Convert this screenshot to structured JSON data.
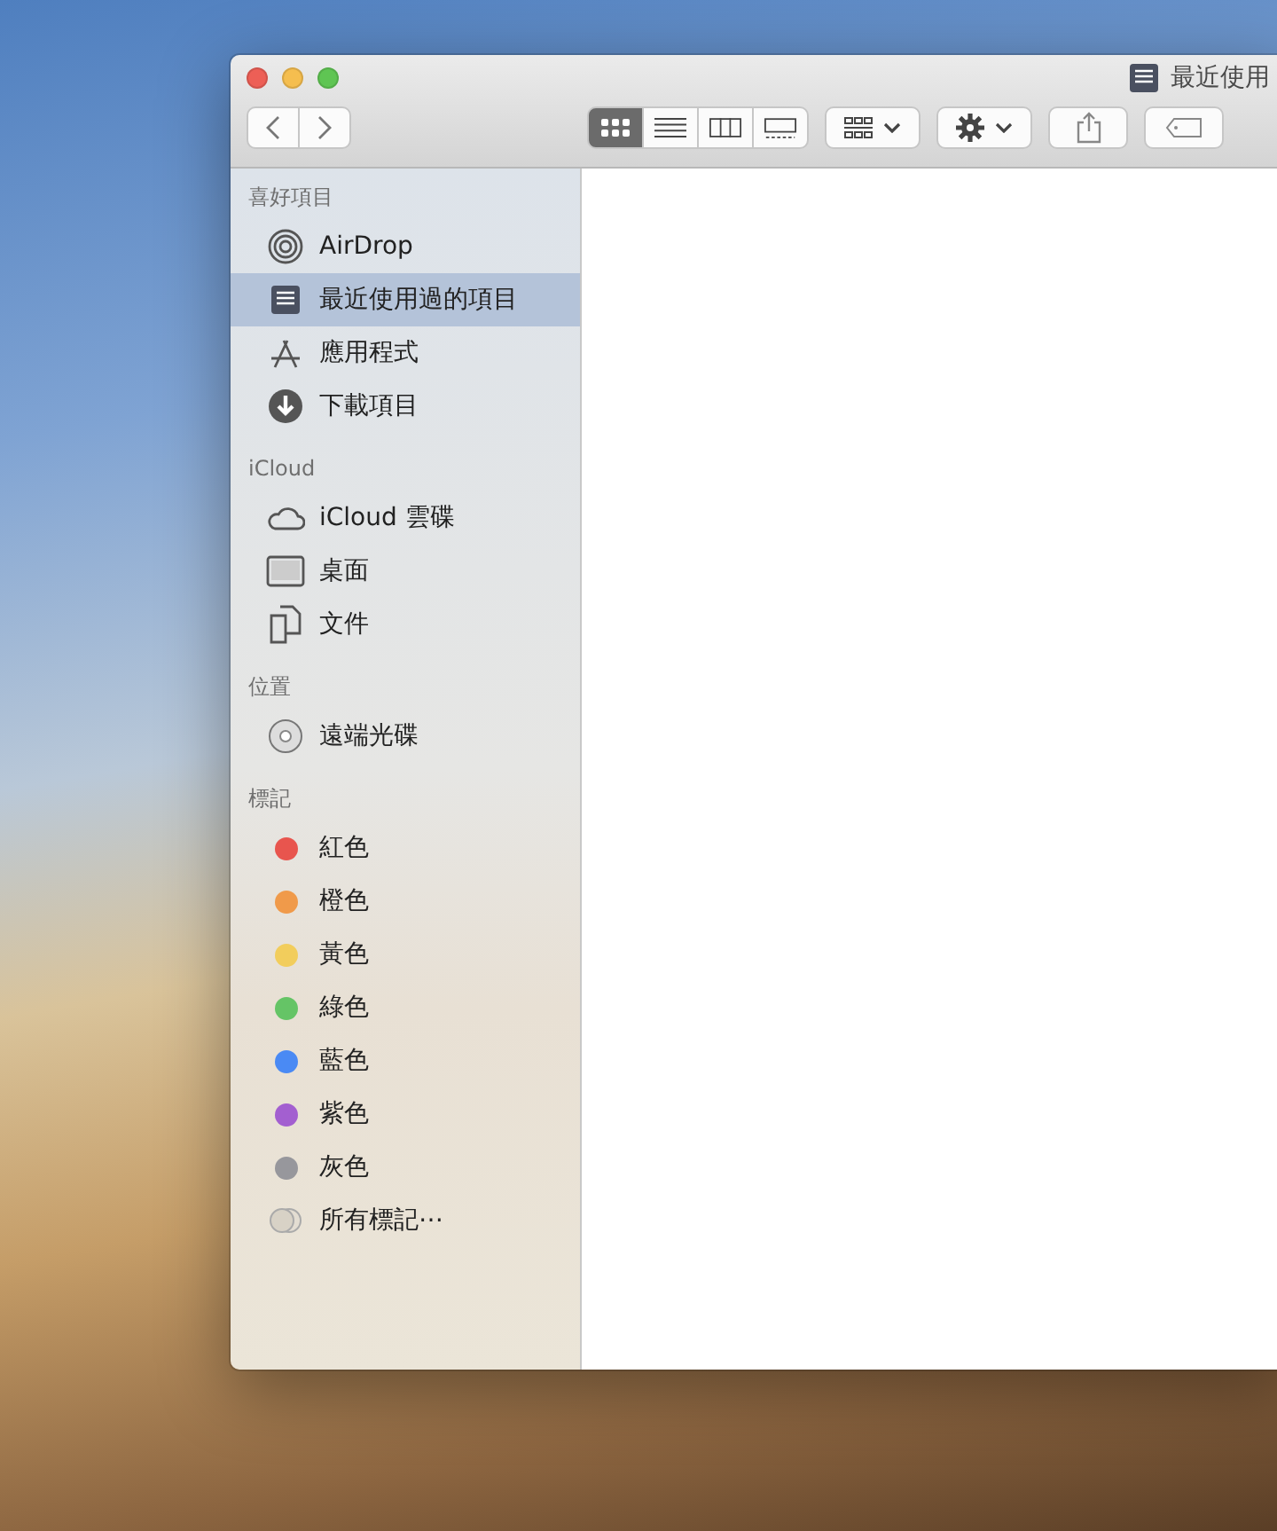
{
  "window": {
    "title": "最近使用"
  },
  "toolbar": {
    "view_modes": [
      {
        "kind": "icons",
        "selected": true
      },
      {
        "kind": "list",
        "selected": false
      },
      {
        "kind": "columns",
        "selected": false
      },
      {
        "kind": "gallery",
        "selected": false
      }
    ]
  },
  "sidebar": {
    "sections": [
      {
        "heading": "喜好項目",
        "items": [
          {
            "kind": "airdrop",
            "label": "AirDrop",
            "selected": false
          },
          {
            "kind": "recents",
            "label": "最近使用過的項目",
            "selected": true
          },
          {
            "kind": "apps",
            "label": "應用程式",
            "selected": false
          },
          {
            "kind": "downloads",
            "label": "下載項目",
            "selected": false
          }
        ]
      },
      {
        "heading": "iCloud",
        "items": [
          {
            "kind": "cloud",
            "label": "iCloud 雲碟",
            "selected": false
          },
          {
            "kind": "desktop",
            "label": "桌面",
            "selected": false
          },
          {
            "kind": "documents",
            "label": "文件",
            "selected": false
          }
        ]
      },
      {
        "heading": "位置",
        "items": [
          {
            "kind": "disc",
            "label": "遠端光碟",
            "selected": false
          }
        ]
      },
      {
        "heading": "標記",
        "items": [
          {
            "kind": "tag",
            "label": "紅色",
            "color": "#e8554e",
            "selected": false
          },
          {
            "kind": "tag",
            "label": "橙色",
            "color": "#f09a4a",
            "selected": false
          },
          {
            "kind": "tag",
            "label": "黃色",
            "color": "#f2cd5c",
            "selected": false
          },
          {
            "kind": "tag",
            "label": "綠色",
            "color": "#65c466",
            "selected": false
          },
          {
            "kind": "tag",
            "label": "藍色",
            "color": "#4a8af4",
            "selected": false
          },
          {
            "kind": "tag",
            "label": "紫色",
            "color": "#a35fd0",
            "selected": false
          },
          {
            "kind": "tag",
            "label": "灰色",
            "color": "#97979c",
            "selected": false
          },
          {
            "kind": "alltags",
            "label": "所有標記⋯",
            "selected": false
          }
        ]
      }
    ]
  }
}
